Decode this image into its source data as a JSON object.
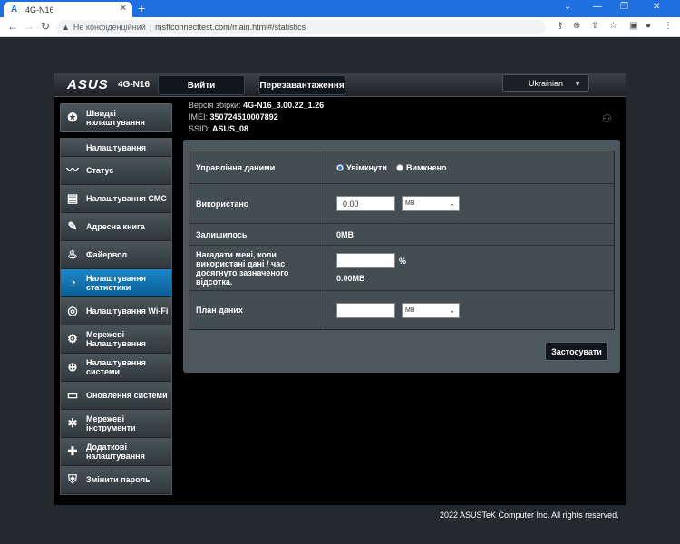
{
  "browser": {
    "tab_title": "4G-N16",
    "tab_logo": "A",
    "new_tab": "+",
    "not_secure": "Не конфіденційний",
    "url": "msftconnecttest.com/main.html#/statistics"
  },
  "header": {
    "logo": "ASUS",
    "model": "4G-N16",
    "logout": "Вийти",
    "reboot": "Перезавантаження",
    "language": "Ukrainian"
  },
  "info": {
    "version_label": "Версія збірки:",
    "version": "4G-N16_3.00.22_1.26",
    "imei_label": "IMEI:",
    "imei": "350724510007892",
    "ssid_label": "SSID:",
    "ssid": "ASUS_08"
  },
  "sidebar": {
    "quick": "Швидкі налаштування",
    "menu_header": "Налаштування",
    "items": [
      {
        "label": "Статус",
        "icon": "activity-icon"
      },
      {
        "label": "Налаштування СМС",
        "icon": "sms-icon"
      },
      {
        "label": "Адресна книга",
        "icon": "address-book-icon"
      },
      {
        "label": "Файервол",
        "icon": "firewall-icon"
      },
      {
        "label": "Налаштування статистики",
        "icon": "statistics-icon"
      },
      {
        "label": "Налаштування Wi-Fi",
        "icon": "wifi-icon"
      },
      {
        "label": "Мережеві Налаштування",
        "icon": "network-icon"
      },
      {
        "label": "Налаштування системи",
        "icon": "globe-icon"
      },
      {
        "label": "Оновлення системи",
        "icon": "update-icon"
      },
      {
        "label": "Мережеві інструменти",
        "icon": "tools-icon"
      },
      {
        "label": "Додаткові налаштування",
        "icon": "advanced-icon"
      },
      {
        "label": "Змінити пароль",
        "icon": "lock-icon"
      }
    ]
  },
  "form": {
    "data_mgmt_label": "Управління даними",
    "enabled": "Увімкнути",
    "disabled": "Вимкнено",
    "used_label": "Використано",
    "used_value": "0.00",
    "unit_mb": "MB",
    "remaining_label": "Залишилось",
    "remaining_value": "0MB",
    "remind_label": "Нагадати мені, коли використані дані / час досягнуто зазначеного відсотка.",
    "percent_sign": "%",
    "remind_value": "0.00MB",
    "plan_label": "План даних",
    "plan_value": "",
    "apply": "Застосувати"
  },
  "footer": "2022 ASUSTeK Computer Inc. All rights reserved."
}
